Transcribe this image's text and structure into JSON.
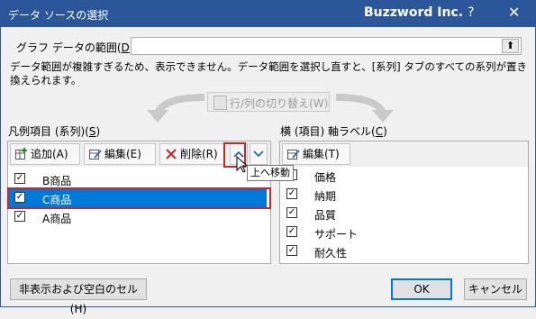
{
  "window": {
    "title": "データ ソースの選択",
    "brand": "Buzzword Inc.",
    "help": "?",
    "close": "✕"
  },
  "range": {
    "label_prefix": "グラフ データの範囲(",
    "label_key": "D",
    "label_suffix": "):",
    "value": "",
    "picker_icon": "⬆"
  },
  "message": "データ範囲が複雑すぎるため、表示できません。データ範囲を選択し直すと、[系列] タブのすべての系列が置き換えられます。",
  "switch_button": {
    "label": "行/列の切り替え(W)"
  },
  "legend": {
    "label_prefix": "凡例項目 (系列)(",
    "label_key": "S",
    "label_suffix": ")",
    "toolbar": {
      "add": "追加(A)",
      "edit": "編集(E)",
      "delete": "削除(R)",
      "move_up_icon": "^",
      "move_down_icon": "v"
    },
    "items": [
      {
        "label": "B商品",
        "checked": true,
        "selected": false
      },
      {
        "label": "C商品",
        "checked": true,
        "selected": true
      },
      {
        "label": "A商品",
        "checked": true,
        "selected": false
      }
    ]
  },
  "tooltip": "上へ移動",
  "axis": {
    "label_prefix": "横 (項目) 軸ラベル(",
    "label_key": "C",
    "label_suffix": ")",
    "toolbar": {
      "edit": "編集(T)"
    },
    "items": [
      {
        "label": "価格",
        "checked": true
      },
      {
        "label": "納期",
        "checked": true
      },
      {
        "label": "品質",
        "checked": true
      },
      {
        "label": "サポート",
        "checked": true
      },
      {
        "label": "耐久性",
        "checked": true
      }
    ]
  },
  "footer": {
    "hidden_cells": "非表示および空白のセル(H)",
    "ok": "OK",
    "cancel": "キャンセル"
  },
  "colors": {
    "title_bar": "#2b579a",
    "selection": "#0078d7",
    "highlight_box": "#c4262e"
  }
}
